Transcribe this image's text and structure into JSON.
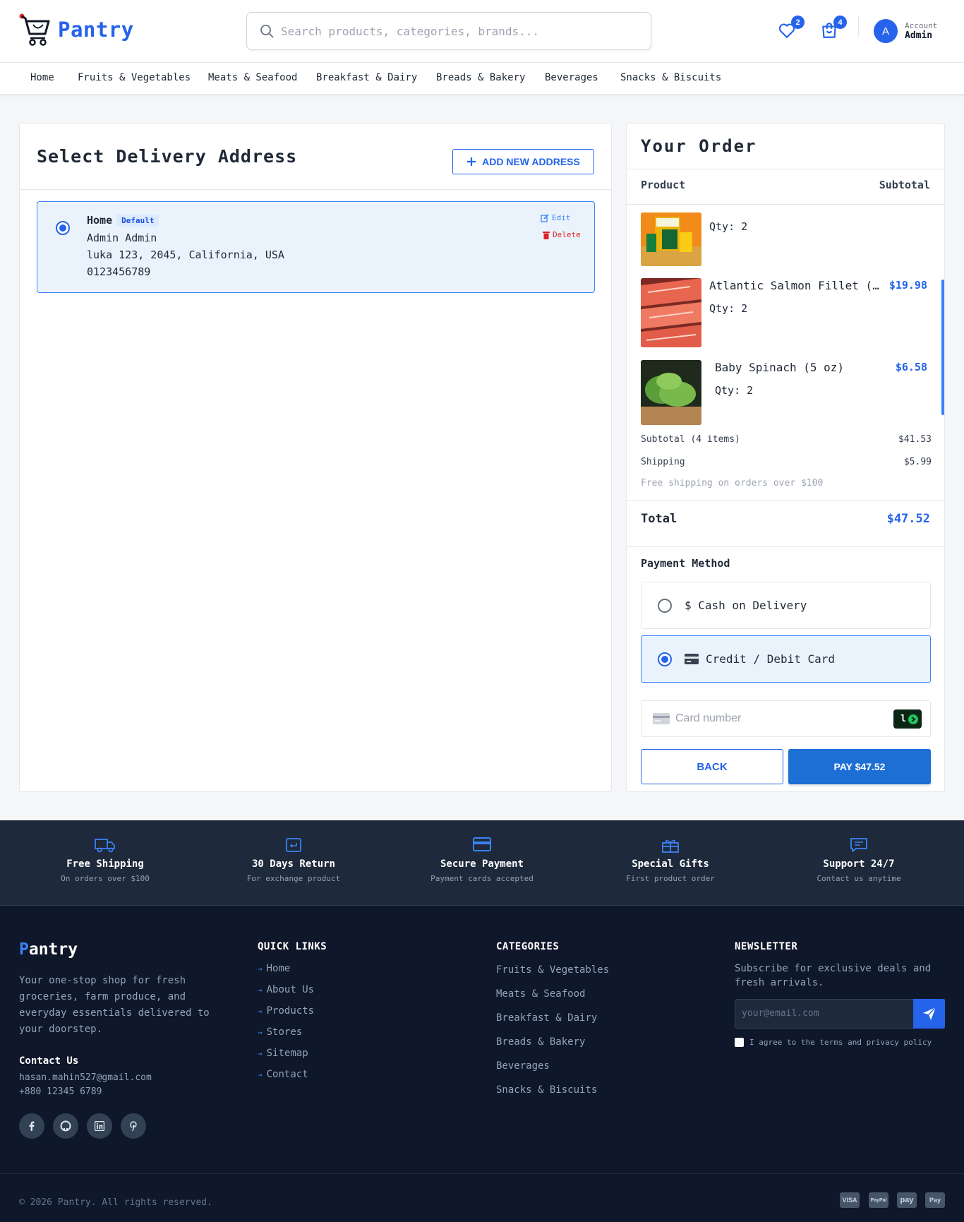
{
  "brand": {
    "name": "Pantry",
    "accent": "#2563eb"
  },
  "header": {
    "search_placeholder": "Search products, categories, brands...",
    "wishlist_count": "2",
    "cart_count": "4",
    "account_label": "Account",
    "account_name": "Admin",
    "avatar_initial": "A"
  },
  "nav": [
    "Home",
    "Fruits & Vegetables",
    "Meats & Seafood",
    "Breakfast & Dairy",
    "Breads & Bakery",
    "Beverages",
    "Snacks & Biscuits"
  ],
  "address": {
    "title": "Select Delivery Address",
    "add_button": "ADD NEW ADDRESS",
    "card": {
      "label": "Home",
      "tag": "Default",
      "name": "Admin Admin",
      "street": "luka 123, 2045, California, USA",
      "phone": "0123456789",
      "edit": "Edit",
      "delete": "Delete",
      "selected": true
    }
  },
  "order": {
    "title": "Your Order",
    "col_product": "Product",
    "col_subtotal": "Subtotal",
    "items": [
      {
        "name": "",
        "qty": "Qty: 2",
        "price": "",
        "image": "product-box-image"
      },
      {
        "name": "Atlantic Salmon Fillet (…",
        "qty": "Qty: 2",
        "price": "$19.98",
        "image": "salmon-image"
      },
      {
        "name": "Baby Spinach (5 oz)",
        "qty": "Qty: 2",
        "price": "$6.58",
        "image": "spinach-image"
      }
    ],
    "subtotal_label": "Subtotal (4 items)",
    "subtotal_value": "$41.53",
    "shipping_label": "Shipping",
    "shipping_value": "$5.99",
    "free_note": "Free shipping on orders over $100",
    "total_label": "Total",
    "total_value": "$47.52",
    "payment_title": "Payment Method",
    "payment_options": [
      {
        "label": "$ Cash on Delivery",
        "selected": false
      },
      {
        "label": "Credit / Debit Card",
        "selected": true
      }
    ],
    "card_placeholder": "Card number",
    "link_badge": "l",
    "back_button": "BACK",
    "pay_button": "PAY $47.52"
  },
  "features": [
    {
      "title": "Free Shipping",
      "sub": "On orders over $100",
      "icon": "truck-icon"
    },
    {
      "title": "30 Days Return",
      "sub": "For exchange product",
      "icon": "return-icon"
    },
    {
      "title": "Secure Payment",
      "sub": "Payment cards accepted",
      "icon": "credit-card-icon"
    },
    {
      "title": "Special Gifts",
      "sub": "First product order",
      "icon": "gift-icon"
    },
    {
      "title": "Support 24/7",
      "sub": "Contact us anytime",
      "icon": "chat-icon"
    }
  ],
  "footer": {
    "brand_first": "P",
    "brand_rest": "antry",
    "description": "Your one-stop shop for fresh groceries, farm produce, and everyday essentials delivered to your doorstep.",
    "contact_title": "Contact Us",
    "email": "hasan.mahin527@gmail.com",
    "phone": "+880 12345 6789",
    "quick_links_title": "QUICK LINKS",
    "quick_links": [
      "Home",
      "About Us",
      "Products",
      "Stores",
      "Sitemap",
      "Contact"
    ],
    "categories_title": "CATEGORIES",
    "categories": [
      "Fruits & Vegetables",
      "Meats & Seafood",
      "Breakfast & Dairy",
      "Breads & Bakery",
      "Beverages",
      "Snacks & Biscuits"
    ],
    "newsletter_title": "NEWSLETTER",
    "newsletter_desc": "Subscribe for exclusive deals and fresh arrivals.",
    "newsletter_placeholder": "your@email.com",
    "agree_text": "I agree to the terms and privacy policy",
    "copyright": "© 2026 Pantry. All rights reserved.",
    "payment_logos": [
      "VISA",
      "PayPal",
      "pay",
      "Pay"
    ]
  }
}
